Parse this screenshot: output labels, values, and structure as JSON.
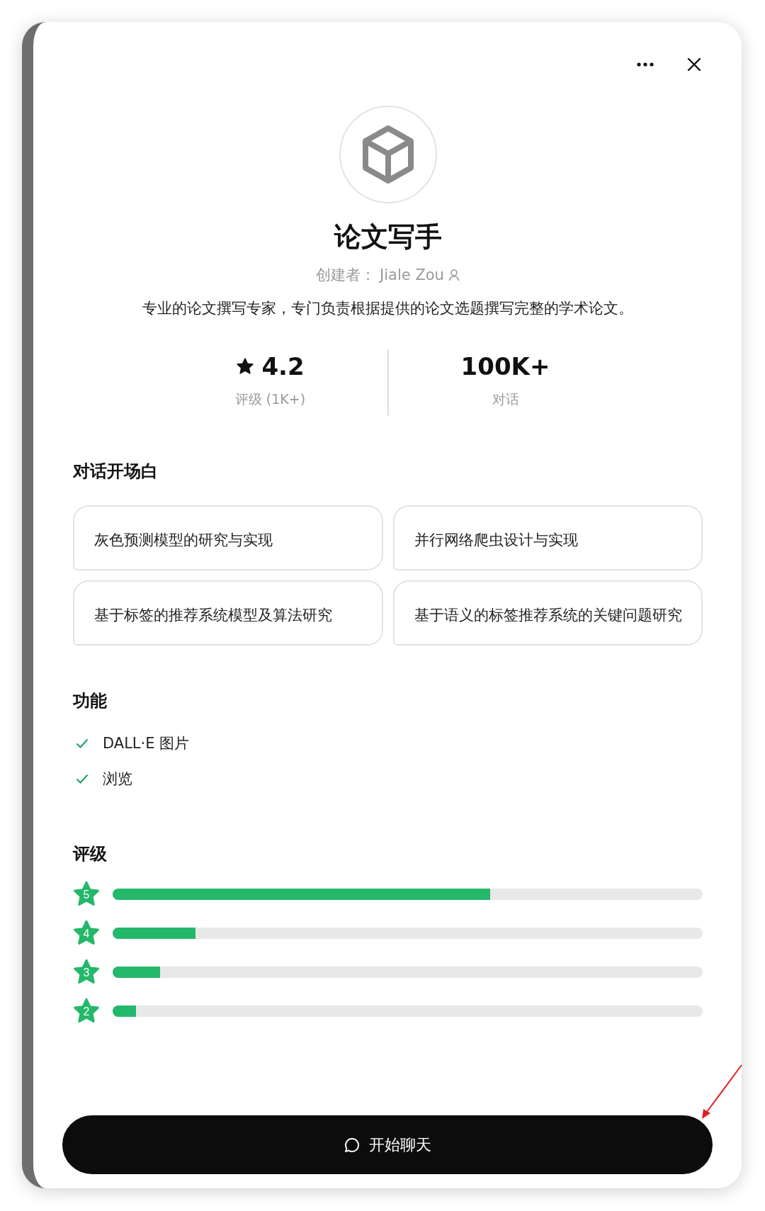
{
  "gpt": {
    "name": "论文写手",
    "creator_label": "创建者：",
    "creator": "Jiale Zou",
    "description": "专业的论文撰写专家，专门负责根据提供的论文选题撰写完整的学术论文。"
  },
  "stats": [
    {
      "kind": "rating",
      "value": "4.2",
      "label": "评级 (1K+)"
    },
    {
      "kind": "plain",
      "value": "100K+",
      "label": "对话"
    }
  ],
  "starters": {
    "title": "对话开场白",
    "items": [
      "灰色预测模型的研究与实现",
      "并行网络爬虫设计与实现",
      "基于标签的推荐系统模型及算法研究",
      "基于语义的标签推荐系统的关键问题研究"
    ]
  },
  "capabilities": {
    "title": "功能",
    "items": [
      {
        "label": "DALL·E 图片",
        "checked": true
      },
      {
        "label": "浏览",
        "checked": true
      }
    ]
  },
  "ratings": {
    "title": "评级",
    "rows": [
      {
        "stars": "5",
        "level": 0.64
      },
      {
        "stars": "4",
        "level": 0.14
      },
      {
        "stars": "3",
        "level": 0.08
      },
      {
        "stars": "2",
        "level": 0.04
      }
    ]
  },
  "start_button": {
    "label": "开始聊天"
  }
}
